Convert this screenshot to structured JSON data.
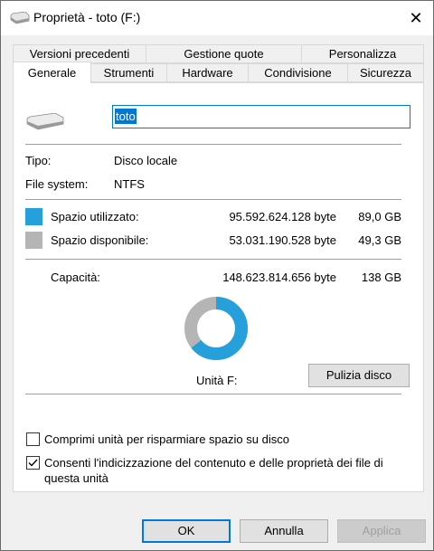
{
  "window": {
    "title": "Proprietà - toto (F:)",
    "close_label": "✕"
  },
  "tabs_row1": [
    {
      "label": "Versioni precedenti"
    },
    {
      "label": "Gestione quote"
    },
    {
      "label": "Personalizza"
    }
  ],
  "tabs_row2": [
    {
      "label": "Generale"
    },
    {
      "label": "Strumenti"
    },
    {
      "label": "Hardware"
    },
    {
      "label": "Condivisione"
    },
    {
      "label": "Sicurezza"
    }
  ],
  "general": {
    "drive_name": "toto",
    "type_label": "Tipo:",
    "type_value": "Disco locale",
    "fs_label": "File system:",
    "fs_value": "NTFS",
    "used_label": "Spazio utilizzato:",
    "used_bytes": "95.592.624.128 byte",
    "used_gb": "89,0 GB",
    "free_label": "Spazio disponibile:",
    "free_bytes": "53.031.190.528 byte",
    "free_gb": "49,3 GB",
    "capacity_label": "Capacità:",
    "capacity_bytes": "148.623.814.656 byte",
    "capacity_gb": "138 GB",
    "drive_label": "Unità F:",
    "cleanup_button": "Pulizia disco",
    "used_fraction": 0.643,
    "used_color": "#26a0da",
    "free_color": "#b5b5b5"
  },
  "options": {
    "compress": {
      "label": "Comprimi unità per risparmiare spazio su disco",
      "checked": false
    },
    "index": {
      "label_line1": "Consenti l'indicizzazione del contenuto e delle proprietà dei file di",
      "label_line2": "questa unità",
      "checked": true
    }
  },
  "buttons": {
    "ok": "OK",
    "cancel": "Annulla",
    "apply": "Applica"
  }
}
